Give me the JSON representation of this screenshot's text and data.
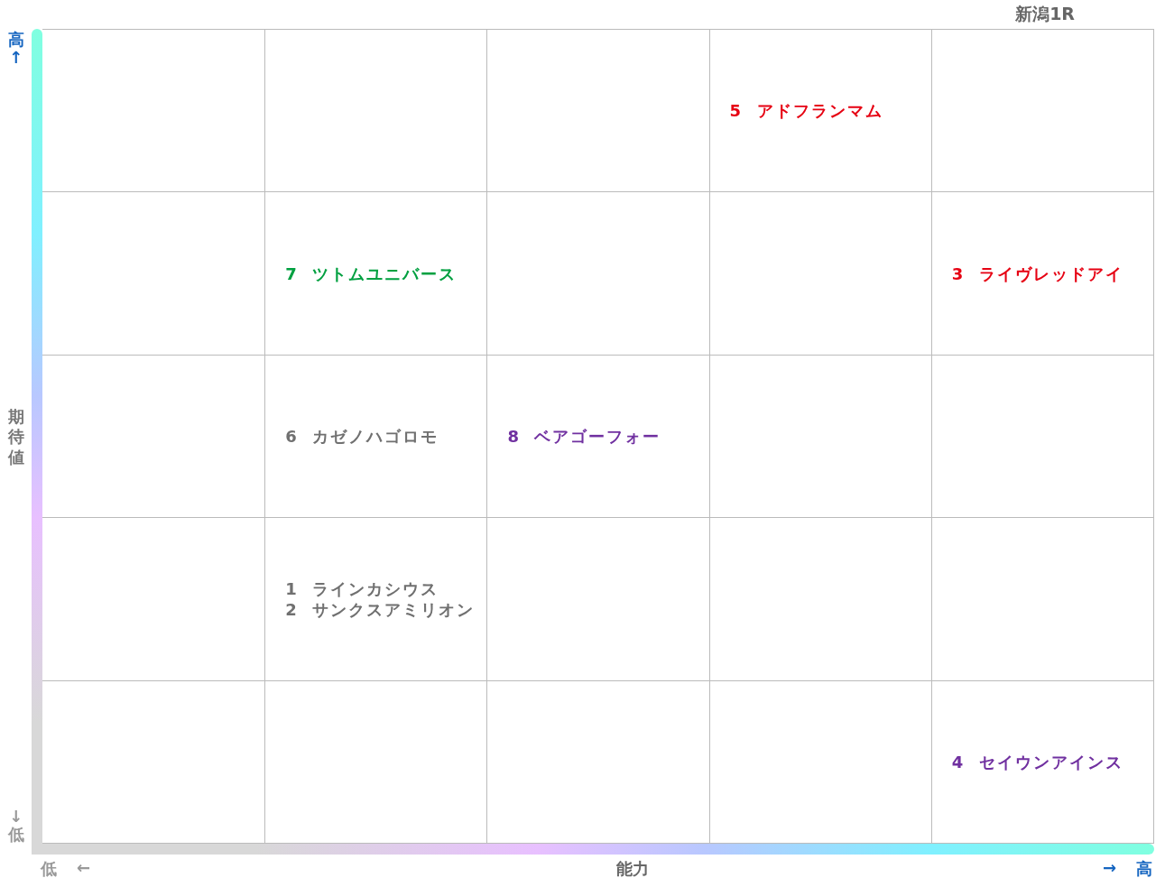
{
  "title": "新潟1R",
  "y_axis": {
    "high_label": "高",
    "high_arrow": "↑",
    "title": "期待値",
    "low_arrow": "↓",
    "low_label": "低"
  },
  "x_axis": {
    "low_label": "低",
    "low_arrow": "←",
    "title": "能力",
    "high_arrow": "→",
    "high_label": "高"
  },
  "grid": {
    "rows": [
      {
        "cells": [
          {},
          {},
          {},
          {
            "entries": [
              {
                "number": "5",
                "name": "アドフランマム",
                "color": "#e60012"
              }
            ]
          },
          {}
        ]
      },
      {
        "cells": [
          {},
          {
            "entries": [
              {
                "number": "7",
                "name": "ツトムユニバース",
                "color": "#00a040"
              }
            ]
          },
          {},
          {},
          {
            "entries": [
              {
                "number": "3",
                "name": "ライヴレッドアイ",
                "color": "#e60012"
              }
            ]
          }
        ]
      },
      {
        "cells": [
          {},
          {
            "entries": [
              {
                "number": "6",
                "name": "カゼノハゴロモ",
                "color": "#707070"
              }
            ]
          },
          {
            "entries": [
              {
                "number": "8",
                "name": "ベアゴーフォー",
                "color": "#7030a0"
              }
            ]
          },
          {},
          {}
        ]
      },
      {
        "cells": [
          {},
          {
            "entries": [
              {
                "number": "1",
                "name": "ラインカシウス",
                "color": "#707070"
              },
              {
                "number": "2",
                "name": "サンクスアミリオン",
                "color": "#707070"
              }
            ]
          },
          {},
          {},
          {}
        ]
      },
      {
        "cells": [
          {},
          {},
          {},
          {},
          {
            "entries": [
              {
                "number": "4",
                "name": "セイウンアインス",
                "color": "#7030a0"
              }
            ]
          }
        ]
      }
    ]
  }
}
